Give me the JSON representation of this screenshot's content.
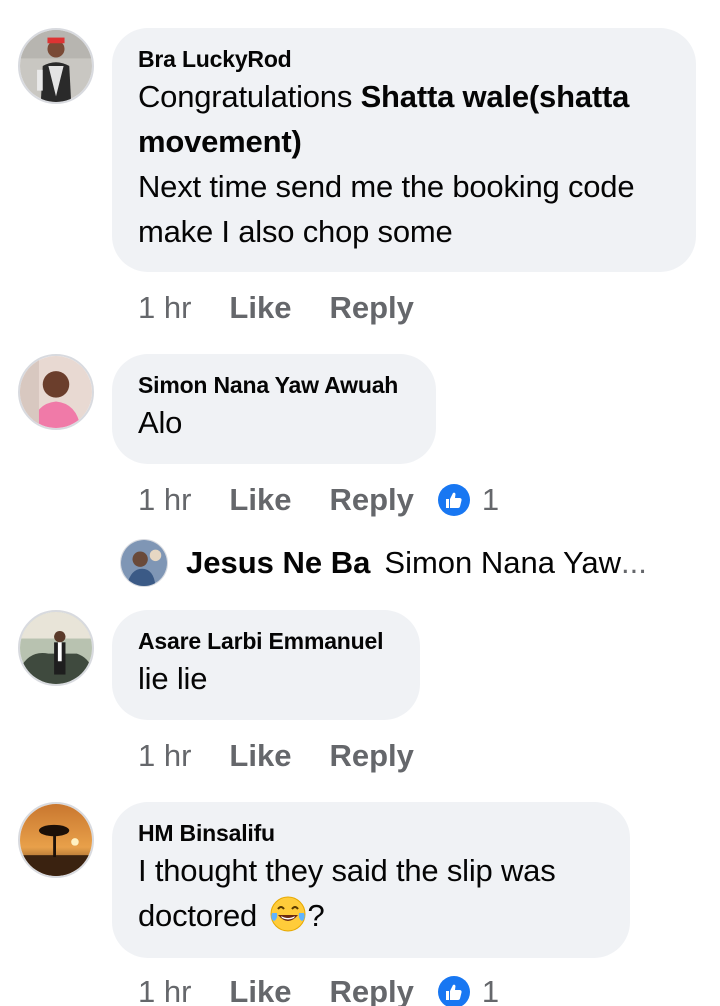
{
  "comments": [
    {
      "author": "Bra LuckyRod",
      "text_before": "Congratulations ",
      "mention": "Shatta wale(shatta movement)",
      "text_line2": "Next time send me the booking code make I also chop some",
      "time": "1 hr",
      "like": "Like",
      "reply": "Reply"
    },
    {
      "author": "Simon Nana Yaw Awuah",
      "text": "Alo",
      "time": "1 hr",
      "like": "Like",
      "reply": "Reply",
      "reaction_count": "1",
      "reaction_icon": "like-thumb-icon"
    },
    {
      "author": "Asare Larbi Emmanuel",
      "text": "lie lie",
      "time": "1 hr",
      "like": "Like",
      "reply": "Reply"
    },
    {
      "author": "HM Binsalifu",
      "text_before": "I thought they said the slip was doctored ",
      "emoji": "face-with-tears-of-joy",
      "text_after": "?",
      "time": "1 hr",
      "like": "Like",
      "reply": "Reply",
      "reaction_count": "1",
      "reaction_icon": "like-thumb-icon"
    }
  ],
  "reply_preview": {
    "author": "Jesus Ne Ba",
    "snippet": "Simon Nana Yaw",
    "ellipsis": "..."
  },
  "colors": {
    "bubble": "#f0f2f5",
    "meta": "#65676b",
    "text": "#050505",
    "like_blue": "#1877f2"
  }
}
